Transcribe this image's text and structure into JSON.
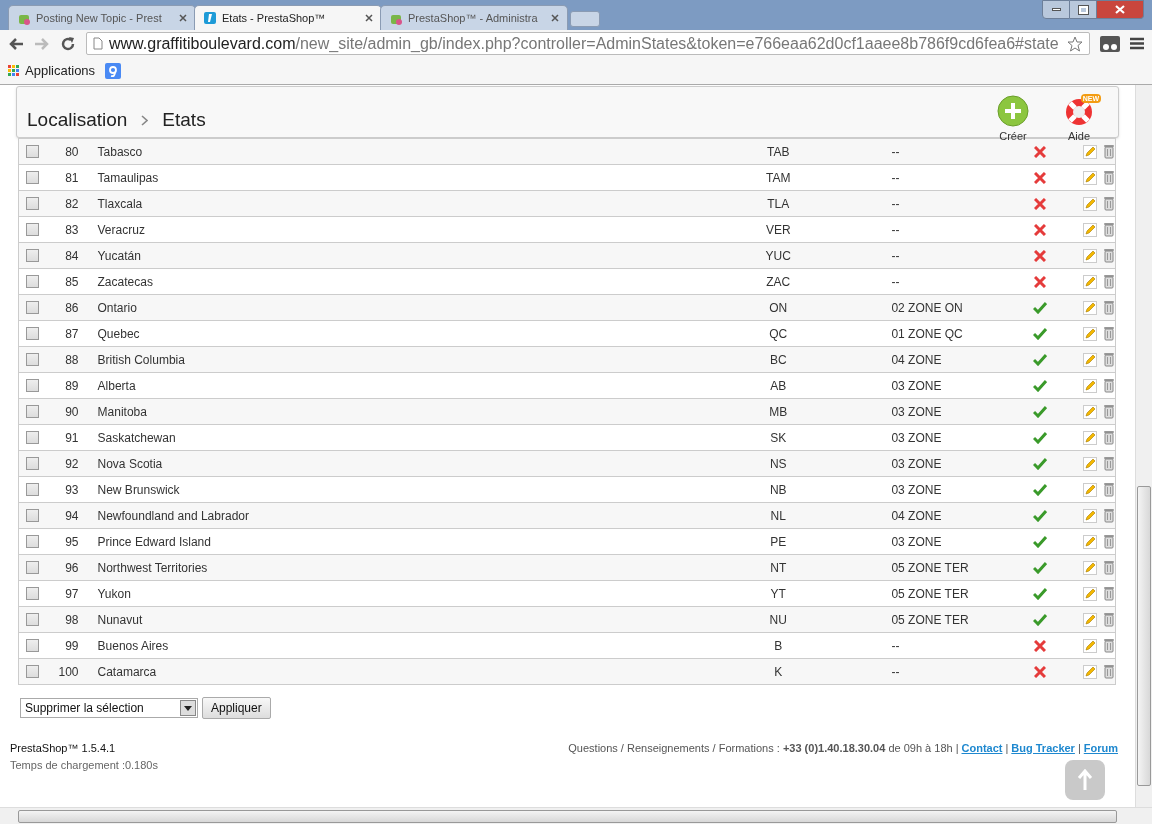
{
  "browser": {
    "tabs": [
      {
        "title": "Posting New Topic - Prest",
        "kind": "shop",
        "selected": false
      },
      {
        "title": "Etats - PrestaShop™",
        "kind": "admin",
        "selected": true
      },
      {
        "title": "PrestaShop™ - Administra",
        "kind": "shop",
        "selected": false
      }
    ],
    "url": {
      "host": "www.graffitiboulevard.com",
      "path": "/new_site/admin_gb/index.php?controller=AdminStates&token=e766eaa62d0cf1aaee8b786f9cd6fea6#state"
    },
    "bookmarks": [
      {
        "label": "Applications",
        "kind": "apps"
      },
      {
        "kind": "google"
      }
    ]
  },
  "toolbar": {
    "breadcrumb": [
      "Localisation",
      "Etats"
    ],
    "buttons": [
      {
        "label": "Créer",
        "kind": "create"
      },
      {
        "label": "Aide",
        "kind": "help",
        "badge": "NEW"
      }
    ]
  },
  "rows": [
    {
      "id": "80",
      "name": "Tabasco",
      "code": "TAB",
      "zone": "--",
      "active": false,
      "checked": false
    },
    {
      "id": "81",
      "name": "Tamaulipas",
      "code": "TAM",
      "zone": "--",
      "active": false,
      "checked": false
    },
    {
      "id": "82",
      "name": "Tlaxcala",
      "code": "TLA",
      "zone": "--",
      "active": false,
      "checked": false
    },
    {
      "id": "83",
      "name": "Veracruz",
      "code": "VER",
      "zone": "--",
      "active": false,
      "checked": false
    },
    {
      "id": "84",
      "name": "Yucatán",
      "code": "YUC",
      "zone": "--",
      "active": false,
      "checked": false
    },
    {
      "id": "85",
      "name": "Zacatecas",
      "code": "ZAC",
      "zone": "--",
      "active": false,
      "checked": false
    },
    {
      "id": "86",
      "name": "Ontario",
      "code": "ON",
      "zone": "02 ZONE ON",
      "active": true,
      "checked": false
    },
    {
      "id": "87",
      "name": "Quebec",
      "code": "QC",
      "zone": "01 ZONE QC",
      "active": true,
      "checked": false
    },
    {
      "id": "88",
      "name": "British Columbia",
      "code": "BC",
      "zone": "04 ZONE",
      "active": true,
      "checked": false
    },
    {
      "id": "89",
      "name": "Alberta",
      "code": "AB",
      "zone": "03 ZONE",
      "active": true,
      "checked": false
    },
    {
      "id": "90",
      "name": "Manitoba",
      "code": "MB",
      "zone": "03 ZONE",
      "active": true,
      "checked": false
    },
    {
      "id": "91",
      "name": "Saskatchewan",
      "code": "SK",
      "zone": "03 ZONE",
      "active": true,
      "checked": false
    },
    {
      "id": "92",
      "name": "Nova Scotia",
      "code": "NS",
      "zone": "03 ZONE",
      "active": true,
      "checked": false
    },
    {
      "id": "93",
      "name": "New Brunswick",
      "code": "NB",
      "zone": "03 ZONE",
      "active": true,
      "checked": false
    },
    {
      "id": "94",
      "name": "Newfoundland and Labrador",
      "code": "NL",
      "zone": "04 ZONE",
      "active": true,
      "checked": false
    },
    {
      "id": "95",
      "name": "Prince Edward Island",
      "code": "PE",
      "zone": "03 ZONE",
      "active": true,
      "checked": false
    },
    {
      "id": "96",
      "name": "Northwest Territories",
      "code": "NT",
      "zone": "05 ZONE TER",
      "active": true,
      "checked": false
    },
    {
      "id": "97",
      "name": "Yukon",
      "code": "YT",
      "zone": "05 ZONE TER",
      "active": true,
      "checked": false
    },
    {
      "id": "98",
      "name": "Nunavut",
      "code": "NU",
      "zone": "05 ZONE TER",
      "active": true,
      "checked": false
    },
    {
      "id": "99",
      "name": "Buenos Aires",
      "code": "B",
      "zone": "--",
      "active": false,
      "checked": false
    },
    {
      "id": "100",
      "name": "Catamarca",
      "code": "K",
      "zone": "--",
      "active": false,
      "checked": false
    }
  ],
  "bulk_action": {
    "value": "Supprimer la sélection",
    "button": "Appliquer"
  },
  "footer": {
    "version": "PrestaShop™ 1.5.4.1",
    "load_time": "Temps de chargement :0.180s",
    "info": "Questions / Renseignements / Formations : **+33 (0)1.40.18.30.04** de 09h à 18h",
    "separator": "|",
    "links": [
      "Contact",
      "Bug Tracker",
      "Forum"
    ]
  }
}
